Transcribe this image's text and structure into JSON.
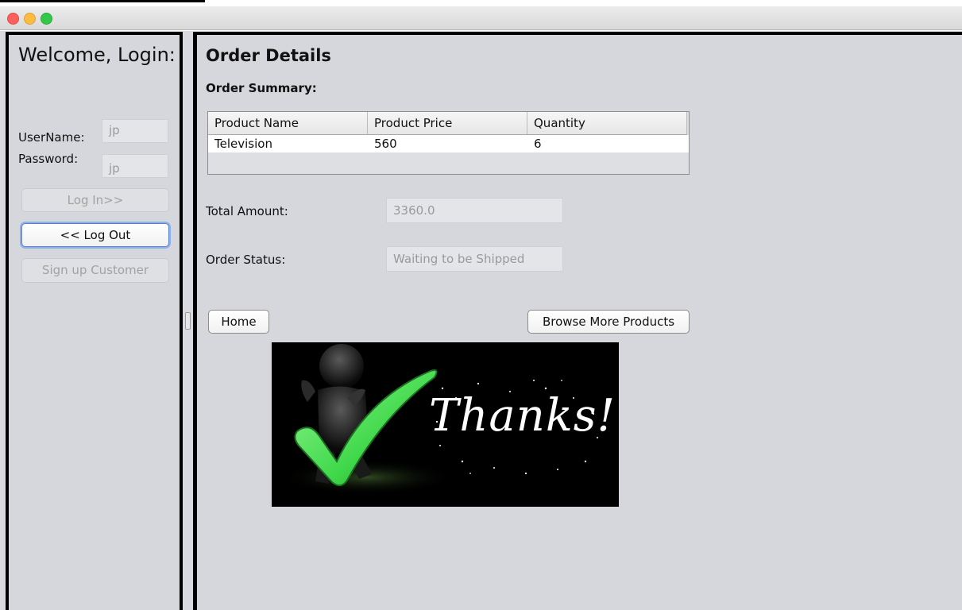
{
  "colors": {
    "panel_border": "#000000",
    "panel_bg": "#d6d7dc",
    "focus_ring": "#8db0e6",
    "check_green": "#3fd84a"
  },
  "window": {
    "controls": [
      "close-icon",
      "minimize-icon",
      "zoom-icon"
    ]
  },
  "login_panel": {
    "welcome": "Welcome, Login:",
    "username_label": "UserName:",
    "username_value": "jp",
    "password_label": "Password:",
    "password_value": "jp",
    "login_button": "Log In>>",
    "logout_button": "<< Log Out",
    "signup_button": "Sign up Customer"
  },
  "order": {
    "title": "Order Details",
    "summary_label": "Order Summary:",
    "table": {
      "columns": [
        "Product Name",
        "Product Price",
        "Quantity"
      ],
      "rows": [
        [
          "Television",
          "560",
          "6"
        ]
      ]
    },
    "total_label": "Total Amount:",
    "total_value": "3360.0",
    "status_label": "Order Status:",
    "status_value": "Waiting to be Shipped",
    "home_button": "Home",
    "browse_button": "Browse More Products",
    "thanks_image_text": "Thanks!"
  }
}
